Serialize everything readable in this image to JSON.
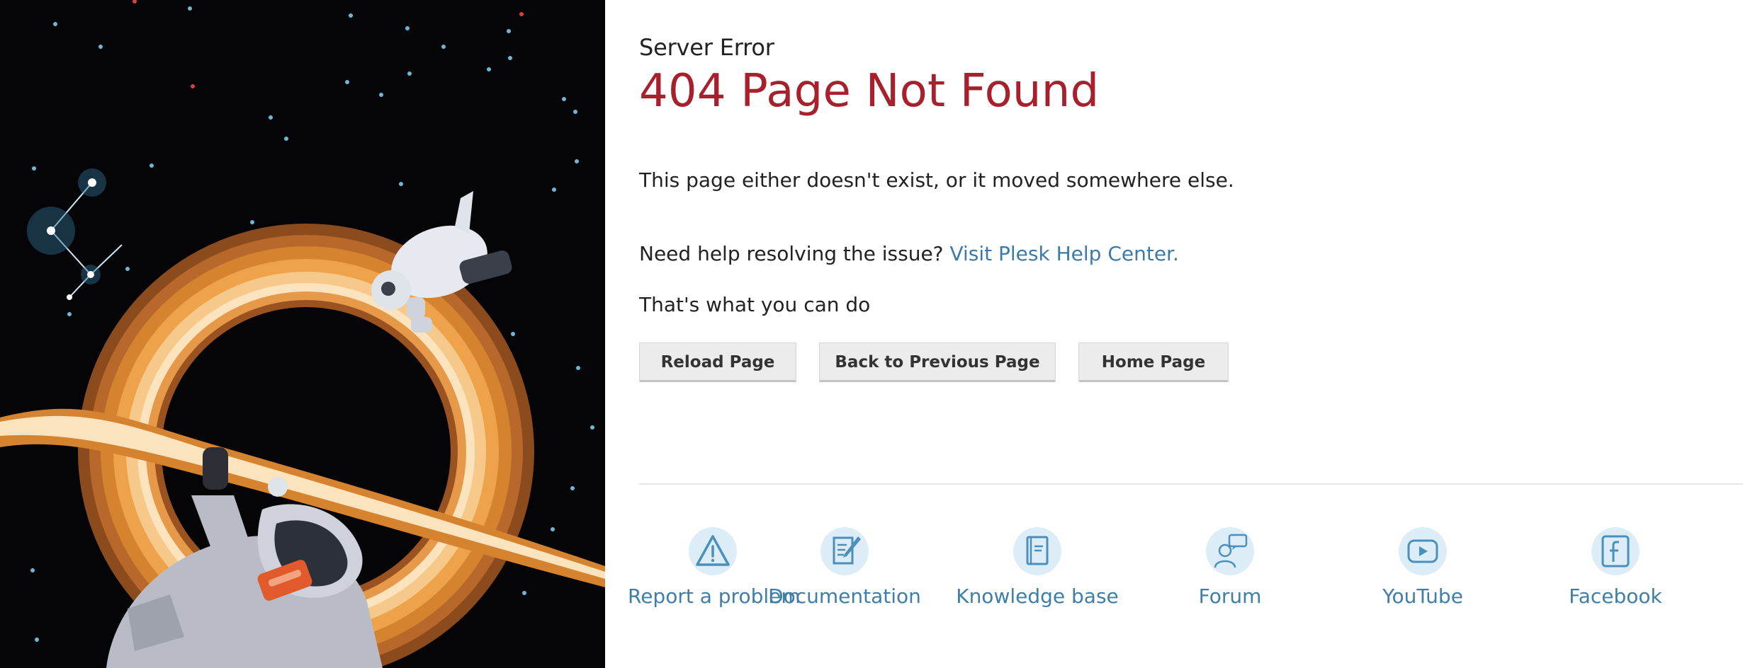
{
  "header": {
    "subtitle": "Server Error",
    "title": "404 Page Not Found"
  },
  "message": {
    "description": "This page either doesn't exist, or it moved somewhere else.",
    "help_prefix": "Need help resolving the issue?",
    "help_link": "Visit Plesk Help Center.",
    "actions_heading": "That's what you can do"
  },
  "actions": {
    "reload": "Reload Page",
    "back": "Back to Previous Page",
    "home": "Home Page"
  },
  "links": [
    {
      "label": "Report a problem",
      "icon": "warning-icon"
    },
    {
      "label": "Documentation",
      "icon": "document-edit-icon"
    },
    {
      "label": "Knowledge base",
      "icon": "book-icon"
    },
    {
      "label": "Forum",
      "icon": "chat-users-icon"
    },
    {
      "label": "YouTube",
      "icon": "play-icon"
    },
    {
      "label": "Facebook",
      "icon": "facebook-icon"
    }
  ],
  "colors": {
    "title": "#a8202c",
    "link": "#3d7fa9",
    "icon_bg": "#dcedf7",
    "background_space": "#050507",
    "ring_orange": "#e08a2c"
  }
}
